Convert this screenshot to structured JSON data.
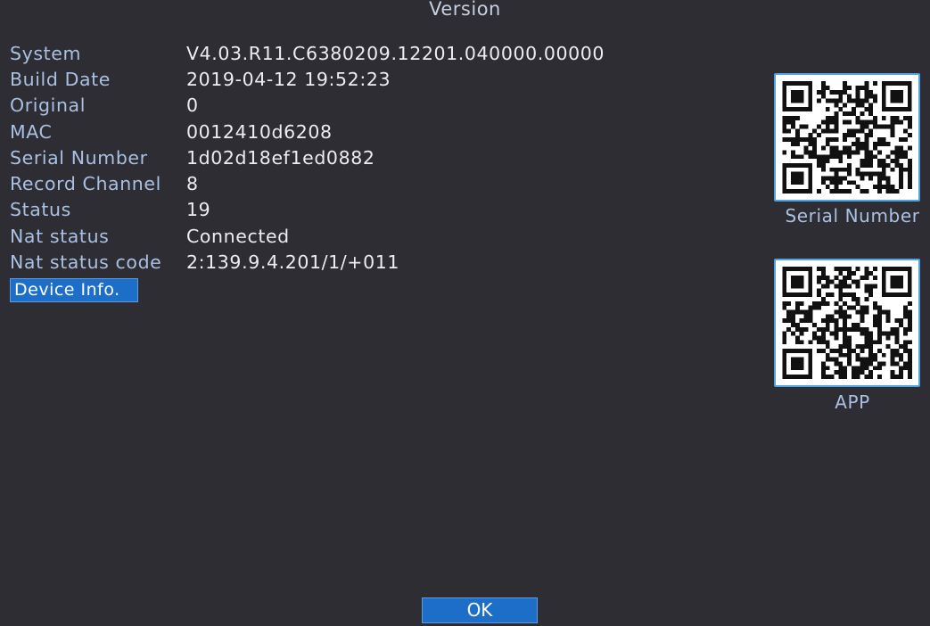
{
  "dialog": {
    "title": "Version"
  },
  "info": [
    {
      "label": "System",
      "value": "V4.03.R11.C6380209.12201.040000.00000"
    },
    {
      "label": "Build Date",
      "value": "2019-04-12 19:52:23"
    },
    {
      "label": "Original",
      "value": "0"
    },
    {
      "label": "MAC",
      "value": "0012410d6208"
    },
    {
      "label": "Serial Number",
      "value": "1d02d18ef1ed0882"
    },
    {
      "label": "Record Channel",
      "value": "8"
    },
    {
      "label": "Status",
      "value": "19"
    },
    {
      "label": "Nat status",
      "value": "Connected"
    },
    {
      "label": "Nat status code",
      "value": "2:139.9.4.201/1/+011"
    }
  ],
  "buttons": {
    "device_info": "Device Info.",
    "ok": "OK"
  },
  "qr": {
    "serial_label": "Serial Number",
    "app_label": "APP"
  },
  "colors": {
    "background": "#2e2d33",
    "label": "#a9c0e3",
    "value": "#ececf1",
    "button": "#1d6ec8",
    "qr_border": "#4fa3e0"
  }
}
